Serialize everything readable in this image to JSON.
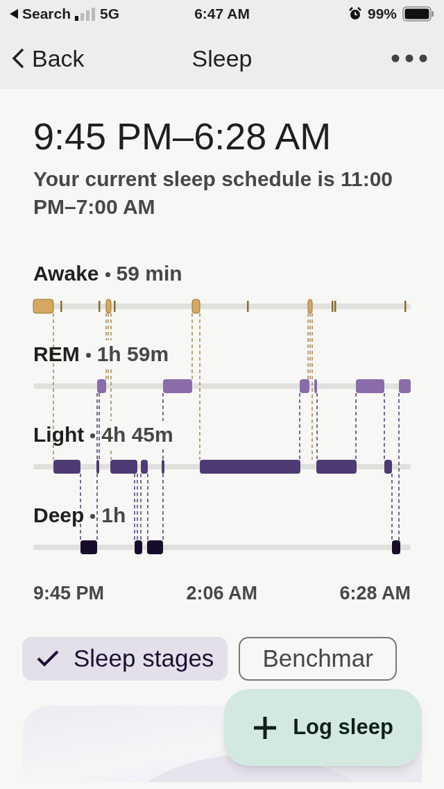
{
  "status_bar": {
    "back_label": "Search",
    "network": "5G",
    "time": "6:47 AM",
    "battery": "99%"
  },
  "nav": {
    "back": "Back",
    "title": "Sleep"
  },
  "period": "9:45 PM–6:28 AM",
  "schedule": "Your current sleep schedule is 11:00 PM–7:00 AM",
  "stages": [
    {
      "name": "Awake",
      "duration": "59 min"
    },
    {
      "name": "REM",
      "duration": "1h 59m"
    },
    {
      "name": "Light",
      "duration": "4h 45m"
    },
    {
      "name": "Deep",
      "duration": "1h"
    }
  ],
  "time_labels": [
    "9:45 PM",
    "2:06 AM",
    "6:28 AM"
  ],
  "chips": [
    {
      "label": "Sleep stages",
      "selected": true
    },
    {
      "label": "Benchmar",
      "selected": false
    }
  ],
  "fab": {
    "label": "Log sleep"
  }
}
